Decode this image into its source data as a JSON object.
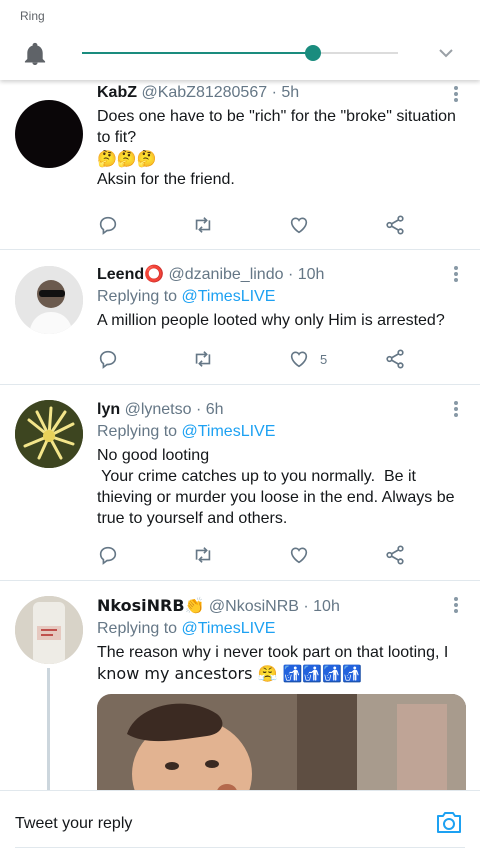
{
  "volume_panel": {
    "label": "Ring",
    "level_percent": 73
  },
  "tweets": [
    {
      "name": "KabZ",
      "handle": "@KabZ81280567",
      "time": "5h",
      "text_lines": [
        "Does one have to be \"rich\" for the \"broke\" situation",
        "to fit?",
        "🤔🤔🤔",
        "Aksin for the friend."
      ],
      "likes": ""
    },
    {
      "name": "Leend⭕",
      "handle": "@dzanibe_lindo",
      "time": "10h",
      "replying_prefix": "Replying to",
      "replying_to": "@TimesLIVE",
      "text_lines": [
        "A million people looted why only Him is arrested?"
      ],
      "likes": "5"
    },
    {
      "name": "lyn",
      "handle": "@lynetso",
      "time": "6h",
      "replying_prefix": "Replying to",
      "replying_to": "@TimesLIVE",
      "text_lines": [
        "No good looting",
        " Your crime catches up to you normally.  Be it",
        "thieving or murder you loose in the end. Always be",
        "true to yourself and others."
      ],
      "likes": ""
    },
    {
      "name": "NkosiNRB👏",
      "handle": "@NkosiNRB",
      "time": "10h",
      "replying_prefix": "Replying to",
      "replying_to": "@TimesLIVE",
      "text_lines": [
        "The reason why i never took part on that looting, I",
        "know my ancestors 😤 🚮🚮🚮🚮"
      ],
      "likes": ""
    }
  ],
  "reply_bar": {
    "placeholder": "Tweet your reply"
  },
  "colors": {
    "accent": "#1a8c7e",
    "link": "#1da1f2",
    "muted": "#657786"
  }
}
